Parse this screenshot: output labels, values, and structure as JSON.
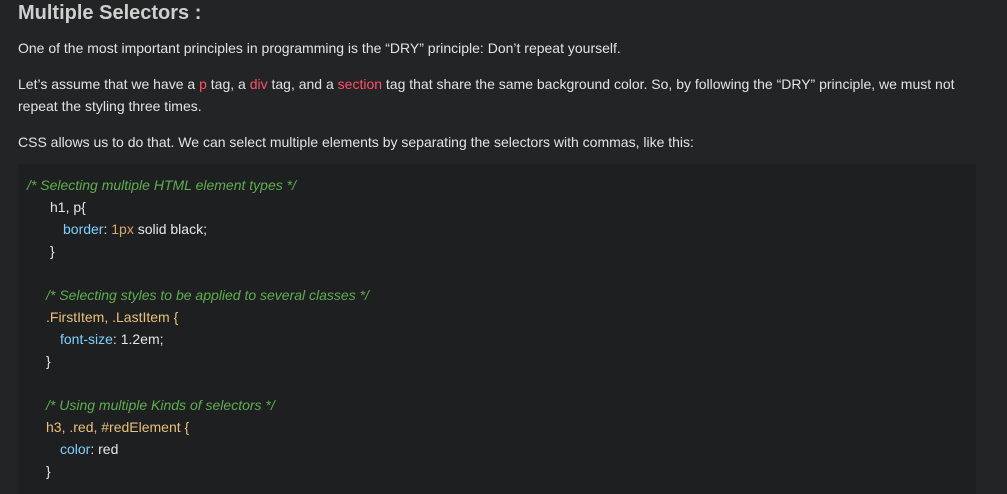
{
  "heading": "Multiple Selectors :",
  "paragraph1": "One of the most important principles in programming is the “DRY” principle: Don’t repeat yourself.",
  "paragraph2": {
    "part1": "Let’s assume that we have a ",
    "tag_p": "p",
    "part2": " tag, a ",
    "tag_div": "div",
    "part3": " tag, and a ",
    "tag_section": "section",
    "part4": " tag that share the same background color. So, by following the “DRY” principle, we must not repeat the styling three times."
  },
  "paragraph3": "CSS allows us to do that. We can select multiple elements by separating the selectors with commas, like this:",
  "code": {
    "comment1": "/* Selecting multiple HTML element types */",
    "selector1": "h1, p{",
    "prop1": "border",
    "colon1": ": ",
    "value1_num": "1px",
    "value1_rest": " solid black;",
    "close1": "}",
    "comment2": "/* Selecting styles to be applied to several classes */",
    "selector2": ".FirstItem, .LastItem {",
    "prop2": "font-size",
    "colon2": ": ",
    "value2": "1.2em;",
    "close2": "}",
    "comment3": "/* Using multiple Kinds of selectors */",
    "selector3": "h3, .red, #redElement {",
    "prop3": "color",
    "colon3": ": ",
    "value3": "red",
    "close3": "}"
  },
  "colors": {
    "background": "#232425",
    "code_background": "#1e1f20",
    "tag_highlight": "#ff4f6a",
    "comment": "#5fae4f",
    "property": "#7fd0ff"
  }
}
